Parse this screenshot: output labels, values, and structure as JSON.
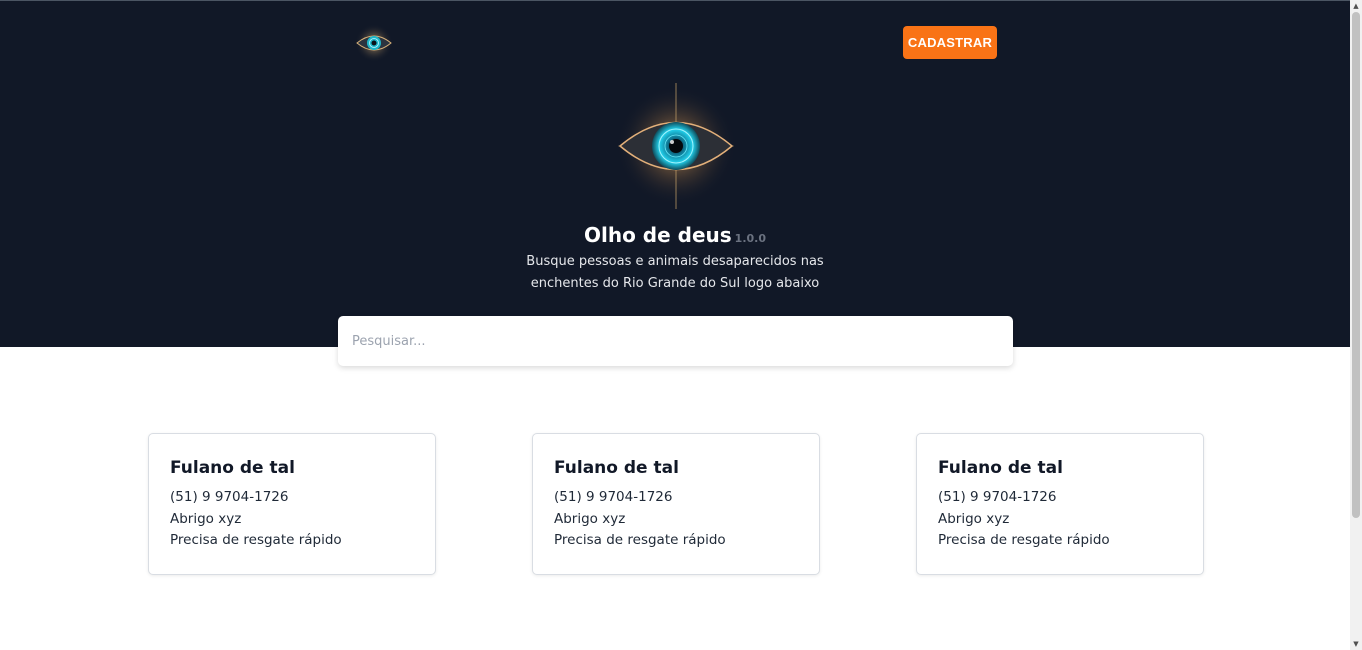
{
  "header": {
    "logo_icon": "eye-icon",
    "cta_label": "CADASTRAR"
  },
  "hero": {
    "logo_icon": "eye-icon",
    "title": "Olho de deus",
    "version": "1.0.0",
    "subtitle": "Busque pessoas e animais desaparecidos nas enchentes do Rio Grande do Sul logo abaixo"
  },
  "search": {
    "placeholder": "Pesquisar..."
  },
  "cards": [
    {
      "name": "Fulano de tal",
      "phone": "(51) 9 9704-1726",
      "shelter": "Abrigo xyz",
      "note": "Precisa de resgate rápido"
    },
    {
      "name": "Fulano de tal",
      "phone": "(51) 9 9704-1726",
      "shelter": "Abrigo xyz",
      "note": "Precisa de resgate rápido"
    },
    {
      "name": "Fulano de tal",
      "phone": "(51) 9 9704-1726",
      "shelter": "Abrigo xyz",
      "note": "Precisa de resgate rápido"
    }
  ],
  "colors": {
    "hero_bg": "#111827",
    "accent": "#f97316"
  }
}
